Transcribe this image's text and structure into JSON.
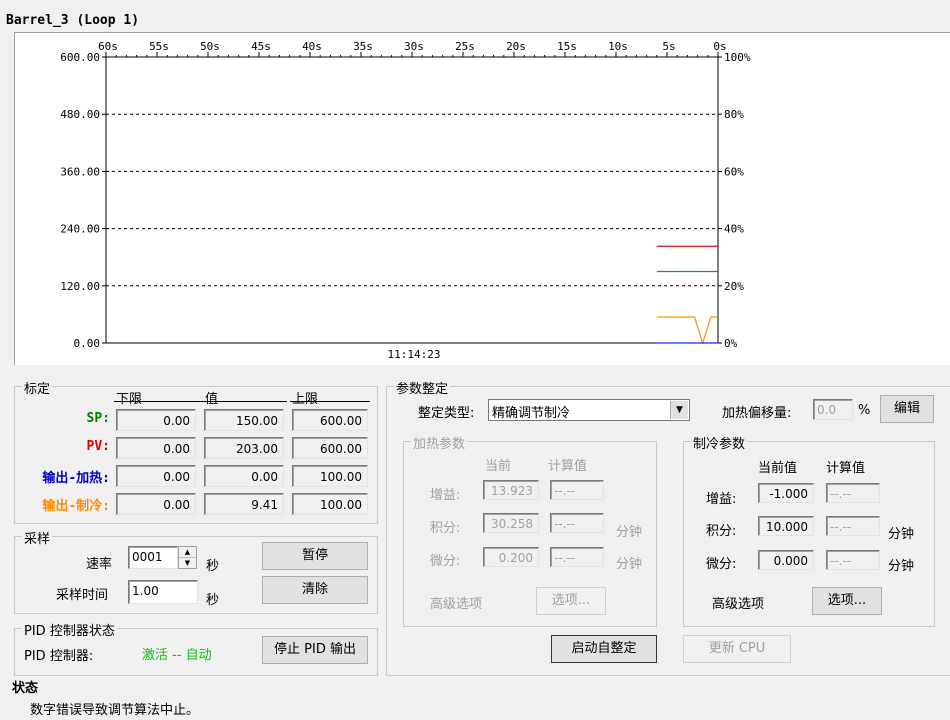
{
  "window_title": "Barrel_3 (Loop 1)",
  "chart_data": {
    "type": "line",
    "x_ticks": [
      "60s",
      "55s",
      "50s",
      "45s",
      "40s",
      "35s",
      "30s",
      "25s",
      "20s",
      "15s",
      "10s",
      "5s",
      "0s"
    ],
    "y_ticks": [
      "600.00",
      "480.00",
      "360.00",
      "240.00",
      "120.00",
      "0.00"
    ],
    "y2_ticks": [
      "100%",
      "80%",
      "60%",
      "40%",
      "20%",
      "0%"
    ],
    "ylim": [
      0,
      600
    ],
    "y2lim": [
      0,
      100
    ],
    "time_label": "11:14:23",
    "grid": "dashed",
    "series": [
      {
        "color": "#e01010",
        "x": [
          -6,
          0
        ],
        "y": [
          203,
          203
        ]
      },
      {
        "color": "#10a010",
        "x": [
          -6,
          0
        ],
        "y": [
          150,
          150
        ]
      },
      {
        "color": "#ff8c00",
        "x": [
          -6,
          -2.3,
          -1.5,
          -0.7,
          0
        ],
        "y": [
          54.6,
          54.6,
          0,
          54.6,
          54.6
        ]
      },
      {
        "color": "#2020ff",
        "x": [
          -6,
          0
        ],
        "y": [
          0,
          0
        ]
      }
    ]
  },
  "calib": {
    "legend": "标定",
    "col_low": "下限",
    "col_val": "值",
    "col_high": "上限",
    "rows": [
      {
        "label": "SP:",
        "color": "#008000",
        "low": "0.00",
        "val": "150.00",
        "high": "600.00"
      },
      {
        "label": "PV:",
        "color": "#e00000",
        "low": "0.00",
        "val": "203.00",
        "high": "600.00"
      },
      {
        "label": "输出-加热:",
        "color": "#0000c0",
        "low": "0.00",
        "val": "0.00",
        "high": "100.00"
      },
      {
        "label": "输出-制冷:",
        "color": "#ff8c00",
        "low": "0.00",
        "val": "9.41",
        "high": "100.00"
      }
    ]
  },
  "sampling": {
    "legend": "采样",
    "rate_label": "速率",
    "rate_value": "0001",
    "rate_unit": "秒",
    "time_label": "采样时间",
    "time_value": "1.00",
    "time_unit": "秒",
    "pause_btn": "暂停",
    "clear_btn": "清除"
  },
  "pid": {
    "legend": "PID 控制器状态",
    "label": "PID 控制器:",
    "status": "激活 -- 自动",
    "stop_btn": "停止 PID 输出"
  },
  "status": {
    "heading": "状态",
    "message": "数字错误导致调节算法中止。"
  },
  "tuning": {
    "legend": "参数整定",
    "type_label": "整定类型:",
    "type_value": "精确调节制冷",
    "offset_label": "加热偏移量:",
    "offset_value": "0.0",
    "offset_unit": "%",
    "edit_btn": "编辑",
    "start_btn": "启动自整定",
    "update_btn": "更新 CPU"
  },
  "heat": {
    "legend": "加热参数",
    "col_cur": "当前",
    "col_calc": "计算值",
    "gain_label": "增益:",
    "gain_cur": "13.923",
    "gain_calc": "--.--",
    "int_label": "积分:",
    "int_cur": "30.258",
    "int_calc": "--.--",
    "int_unit": "分钟",
    "der_label": "微分:",
    "der_cur": "0.200",
    "der_calc": "--.--",
    "der_unit": "分钟",
    "adv_label": "高级选项",
    "opt_btn": "选项..."
  },
  "cool": {
    "legend": "制冷参数",
    "col_cur": "当前值",
    "col_calc": "计算值",
    "gain_label": "增益:",
    "gain_cur": "-1.000",
    "gain_calc": "--.--",
    "int_label": "积分:",
    "int_cur": "10.000",
    "int_calc": "--.--",
    "int_unit": "分钟",
    "der_label": "微分:",
    "der_cur": "0.000",
    "der_calc": "--.--",
    "der_unit": "分钟",
    "adv_label": "高级选项",
    "opt_btn": "选项..."
  }
}
